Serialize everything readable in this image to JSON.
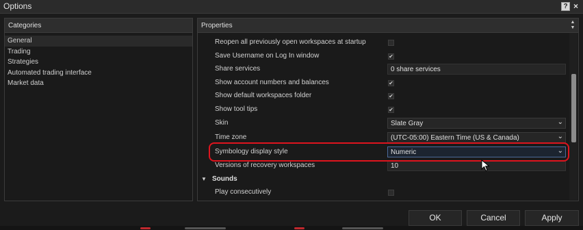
{
  "window": {
    "title": "Options",
    "help_label": "?",
    "close_label": "×"
  },
  "categories": {
    "header": "Categories",
    "items": [
      {
        "label": "General",
        "selected": true
      },
      {
        "label": "Trading",
        "selected": false
      },
      {
        "label": "Strategies",
        "selected": false
      },
      {
        "label": "Automated trading interface",
        "selected": false
      },
      {
        "label": "Market data",
        "selected": false
      }
    ]
  },
  "properties": {
    "header": "Properties",
    "rows": [
      {
        "label": "Reopen all previously open workspaces at startup",
        "type": "checkbox",
        "checked": false
      },
      {
        "label": "Save Username on Log In window",
        "type": "checkbox",
        "checked": true
      },
      {
        "label": "Share services",
        "type": "text",
        "value": "0 share services"
      },
      {
        "label": "Show account numbers and balances",
        "type": "checkbox",
        "checked": true
      },
      {
        "label": "Show default workspaces folder",
        "type": "checkbox",
        "checked": true
      },
      {
        "label": "Show tool tips",
        "type": "checkbox",
        "checked": true
      },
      {
        "label": "Skin",
        "type": "select",
        "value": "Slate Gray"
      },
      {
        "label": "Time zone",
        "type": "select",
        "value": "(UTC-05:00) Eastern Time (US & Canada)"
      },
      {
        "label": "Symbology display style",
        "type": "select",
        "value": "Numeric",
        "active": true
      },
      {
        "label": "Versions of recovery workspaces",
        "type": "text",
        "value": "10"
      }
    ],
    "sounds_section": {
      "label": "Sounds",
      "rows": [
        {
          "label": "Play consecutively",
          "type": "checkbox",
          "checked": false
        }
      ]
    }
  },
  "buttons": {
    "ok": "OK",
    "cancel": "Cancel",
    "apply": "Apply"
  },
  "glyphs": {
    "check": "✔",
    "chevron": "⌄",
    "triangle_down": "▼",
    "scroll_up": "▲",
    "scroll_down": "▼"
  },
  "colors": {
    "highlight": "#e0141e",
    "background": "#1a1a1a",
    "header": "#2e2e2e"
  }
}
